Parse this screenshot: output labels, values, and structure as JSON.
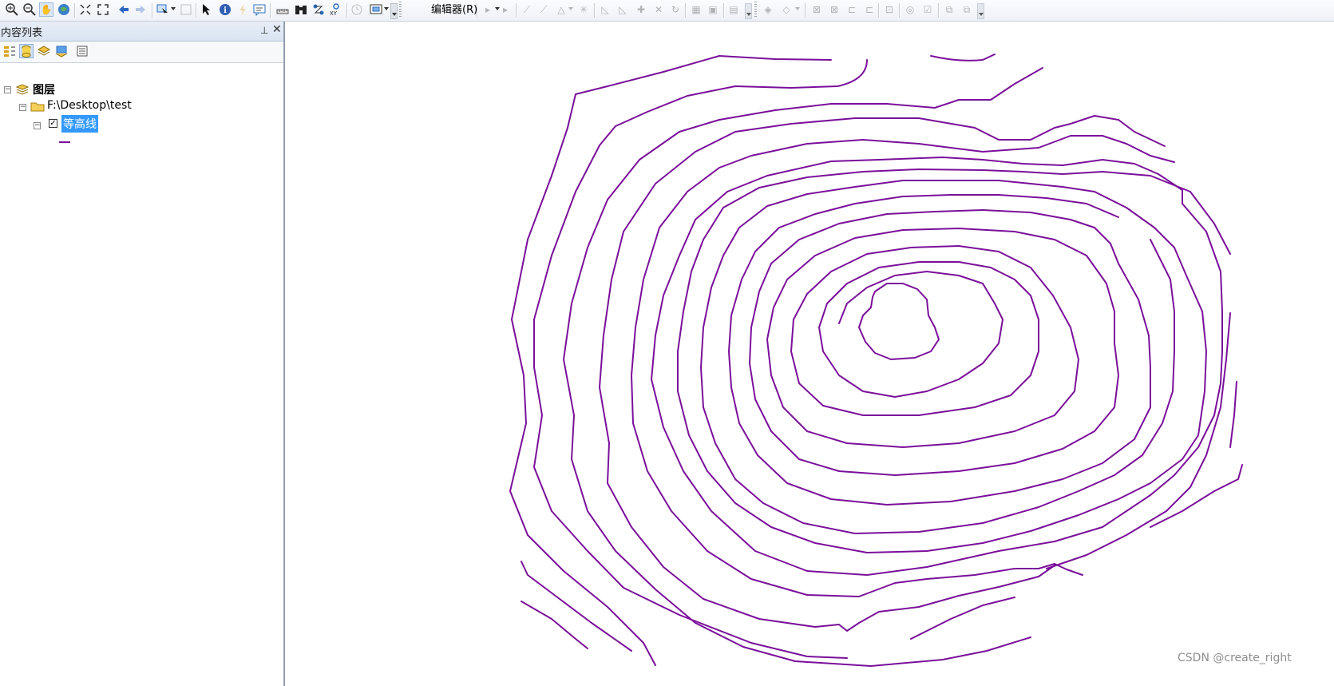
{
  "toolbar": {
    "editor_menu_label": "编辑器(R)",
    "tools": [
      {
        "icon": "zoom-in-icon"
      },
      {
        "icon": "zoom-out-icon"
      },
      {
        "icon": "pan-icon"
      },
      {
        "icon": "full-extent-icon"
      },
      {
        "icon": "fixed-zoom-in-icon"
      },
      {
        "icon": "fixed-zoom-out-icon"
      },
      {
        "icon": "back-extent-icon"
      },
      {
        "icon": "forward-extent-icon"
      },
      {
        "icon": "select-features-icon"
      },
      {
        "icon": "clear-selection-icon"
      },
      {
        "icon": "select-elements-icon"
      },
      {
        "icon": "identify-icon"
      },
      {
        "icon": "hyperlink-icon"
      },
      {
        "icon": "html-popup-icon"
      },
      {
        "icon": "measure-icon"
      },
      {
        "icon": "find-icon"
      },
      {
        "icon": "find-route-icon"
      },
      {
        "icon": "go-to-xy-icon"
      },
      {
        "icon": "time-slider-icon"
      },
      {
        "icon": "create-viewer-icon"
      }
    ]
  },
  "toc": {
    "title": "内容列表",
    "root_label": "图层",
    "folder_label": "F:\\Desktop\\test",
    "layer_label": "等高线",
    "layer_checked": true,
    "layer_color": "#7a0f9a"
  },
  "map": {
    "line_color": "#7a0f9a",
    "background": "#ffffff"
  },
  "watermark": "CSDN @create_right"
}
